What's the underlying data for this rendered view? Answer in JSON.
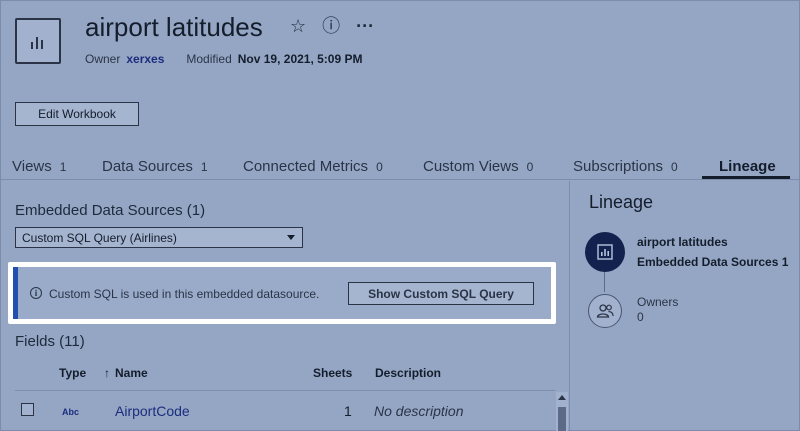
{
  "header": {
    "title": "airport latitudes",
    "actions": {
      "favorite_icon": "☆",
      "info_icon": "ⓘ",
      "more_icon": "···"
    },
    "owner_label": "Owner",
    "owner_name": "xerxes",
    "modified_label": "Modified",
    "modified_value": "Nov 19, 2021, 5:09 PM"
  },
  "toolbar": {
    "edit_label": "Edit Workbook"
  },
  "tabs": [
    {
      "label": "Views",
      "count": "1"
    },
    {
      "label": "Data Sources",
      "count": "1"
    },
    {
      "label": "Connected Metrics",
      "count": "0"
    },
    {
      "label": "Custom Views",
      "count": "0"
    },
    {
      "label": "Subscriptions",
      "count": "0"
    },
    {
      "label": "Lineage",
      "count": ""
    }
  ],
  "main": {
    "embedded_title": "Embedded Data Sources (1)",
    "datasource_select": "Custom SQL Query (Airlines)",
    "info_text": "Custom SQL is used in this embedded datasource.",
    "show_sql_label": "Show Custom SQL Query",
    "fields_title": "Fields (11)",
    "columns": {
      "type": "Type",
      "sort_arrow": "↑",
      "name": "Name",
      "sheets": "Sheets",
      "description": "Description"
    },
    "rows": [
      {
        "type": "Abc",
        "name": "AirportCode",
        "sheets": "1",
        "description": "No description"
      }
    ]
  },
  "lineage": {
    "title": "Lineage",
    "item_name": "airport latitudes",
    "item_sub": "Embedded Data Sources 1",
    "owners_label": "Owners",
    "owners_count": "0"
  },
  "colors": {
    "background": "#95a6c5",
    "accent": "#2150ae",
    "link": "#1b2d7c",
    "lineage_node": "#12214e"
  }
}
